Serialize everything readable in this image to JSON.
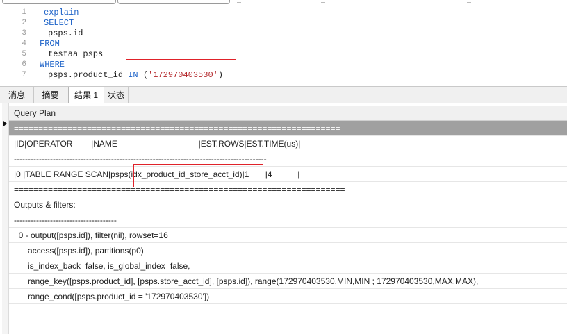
{
  "editor": {
    "lines": [
      {
        "num": "1",
        "parts": [
          {
            "t": "explain",
            "c": "kw"
          }
        ]
      },
      {
        "num": "2",
        "parts": [
          {
            "t": "SELECT",
            "c": "kw"
          }
        ]
      },
      {
        "num": "3",
        "parts": [
          {
            "t": "psps.id",
            "c": "tx"
          }
        ]
      },
      {
        "num": "4",
        "parts": [
          {
            "t": "FROM",
            "c": "kw"
          }
        ]
      },
      {
        "num": "5",
        "parts": [
          {
            "t": "testaa psps",
            "c": "tx"
          }
        ]
      },
      {
        "num": "6",
        "parts": [
          {
            "t": "WHERE",
            "c": "kw"
          }
        ]
      },
      {
        "num": "7",
        "parts": [
          {
            "t": "psps.product_id ",
            "c": "tx"
          },
          {
            "t": "IN",
            "c": "kw"
          },
          {
            "t": " (",
            "c": "tx"
          },
          {
            "t": "'172970403530'",
            "c": "str"
          },
          {
            "t": ")",
            "c": "tx"
          }
        ]
      }
    ]
  },
  "tabs": [
    {
      "label": "消息",
      "active": false
    },
    {
      "label": "摘要",
      "active": false
    },
    {
      "label": "结果 1",
      "active": true
    },
    {
      "label": "状态",
      "active": false
    }
  ],
  "result": {
    "header": "Query Plan",
    "rows": [
      "===================================================================",
      "|ID|OPERATOR        |NAME                                   |EST.ROWS|EST.TIME(us)|",
      "-------------------------------------------------------------------------------------------",
      "|0 |TABLE RANGE SCAN|psps(idx_product_id_store_acct_id)|1       |4           |",
      "====================================================================",
      "Outputs & filters:",
      "-------------------------------------",
      "  0 - output([psps.id]), filter(nil), rowset=16",
      "      access([psps.id]), partitions(p0)",
      "      is_index_back=false, is_global_index=false,",
      "      range_key([psps.product_id], [psps.store_acct_id], [psps.id]), range(172970403530,MIN,MIN ; 172970403530,MAX,MAX),",
      "      range_cond([psps.product_id = '172970403530'])"
    ]
  }
}
